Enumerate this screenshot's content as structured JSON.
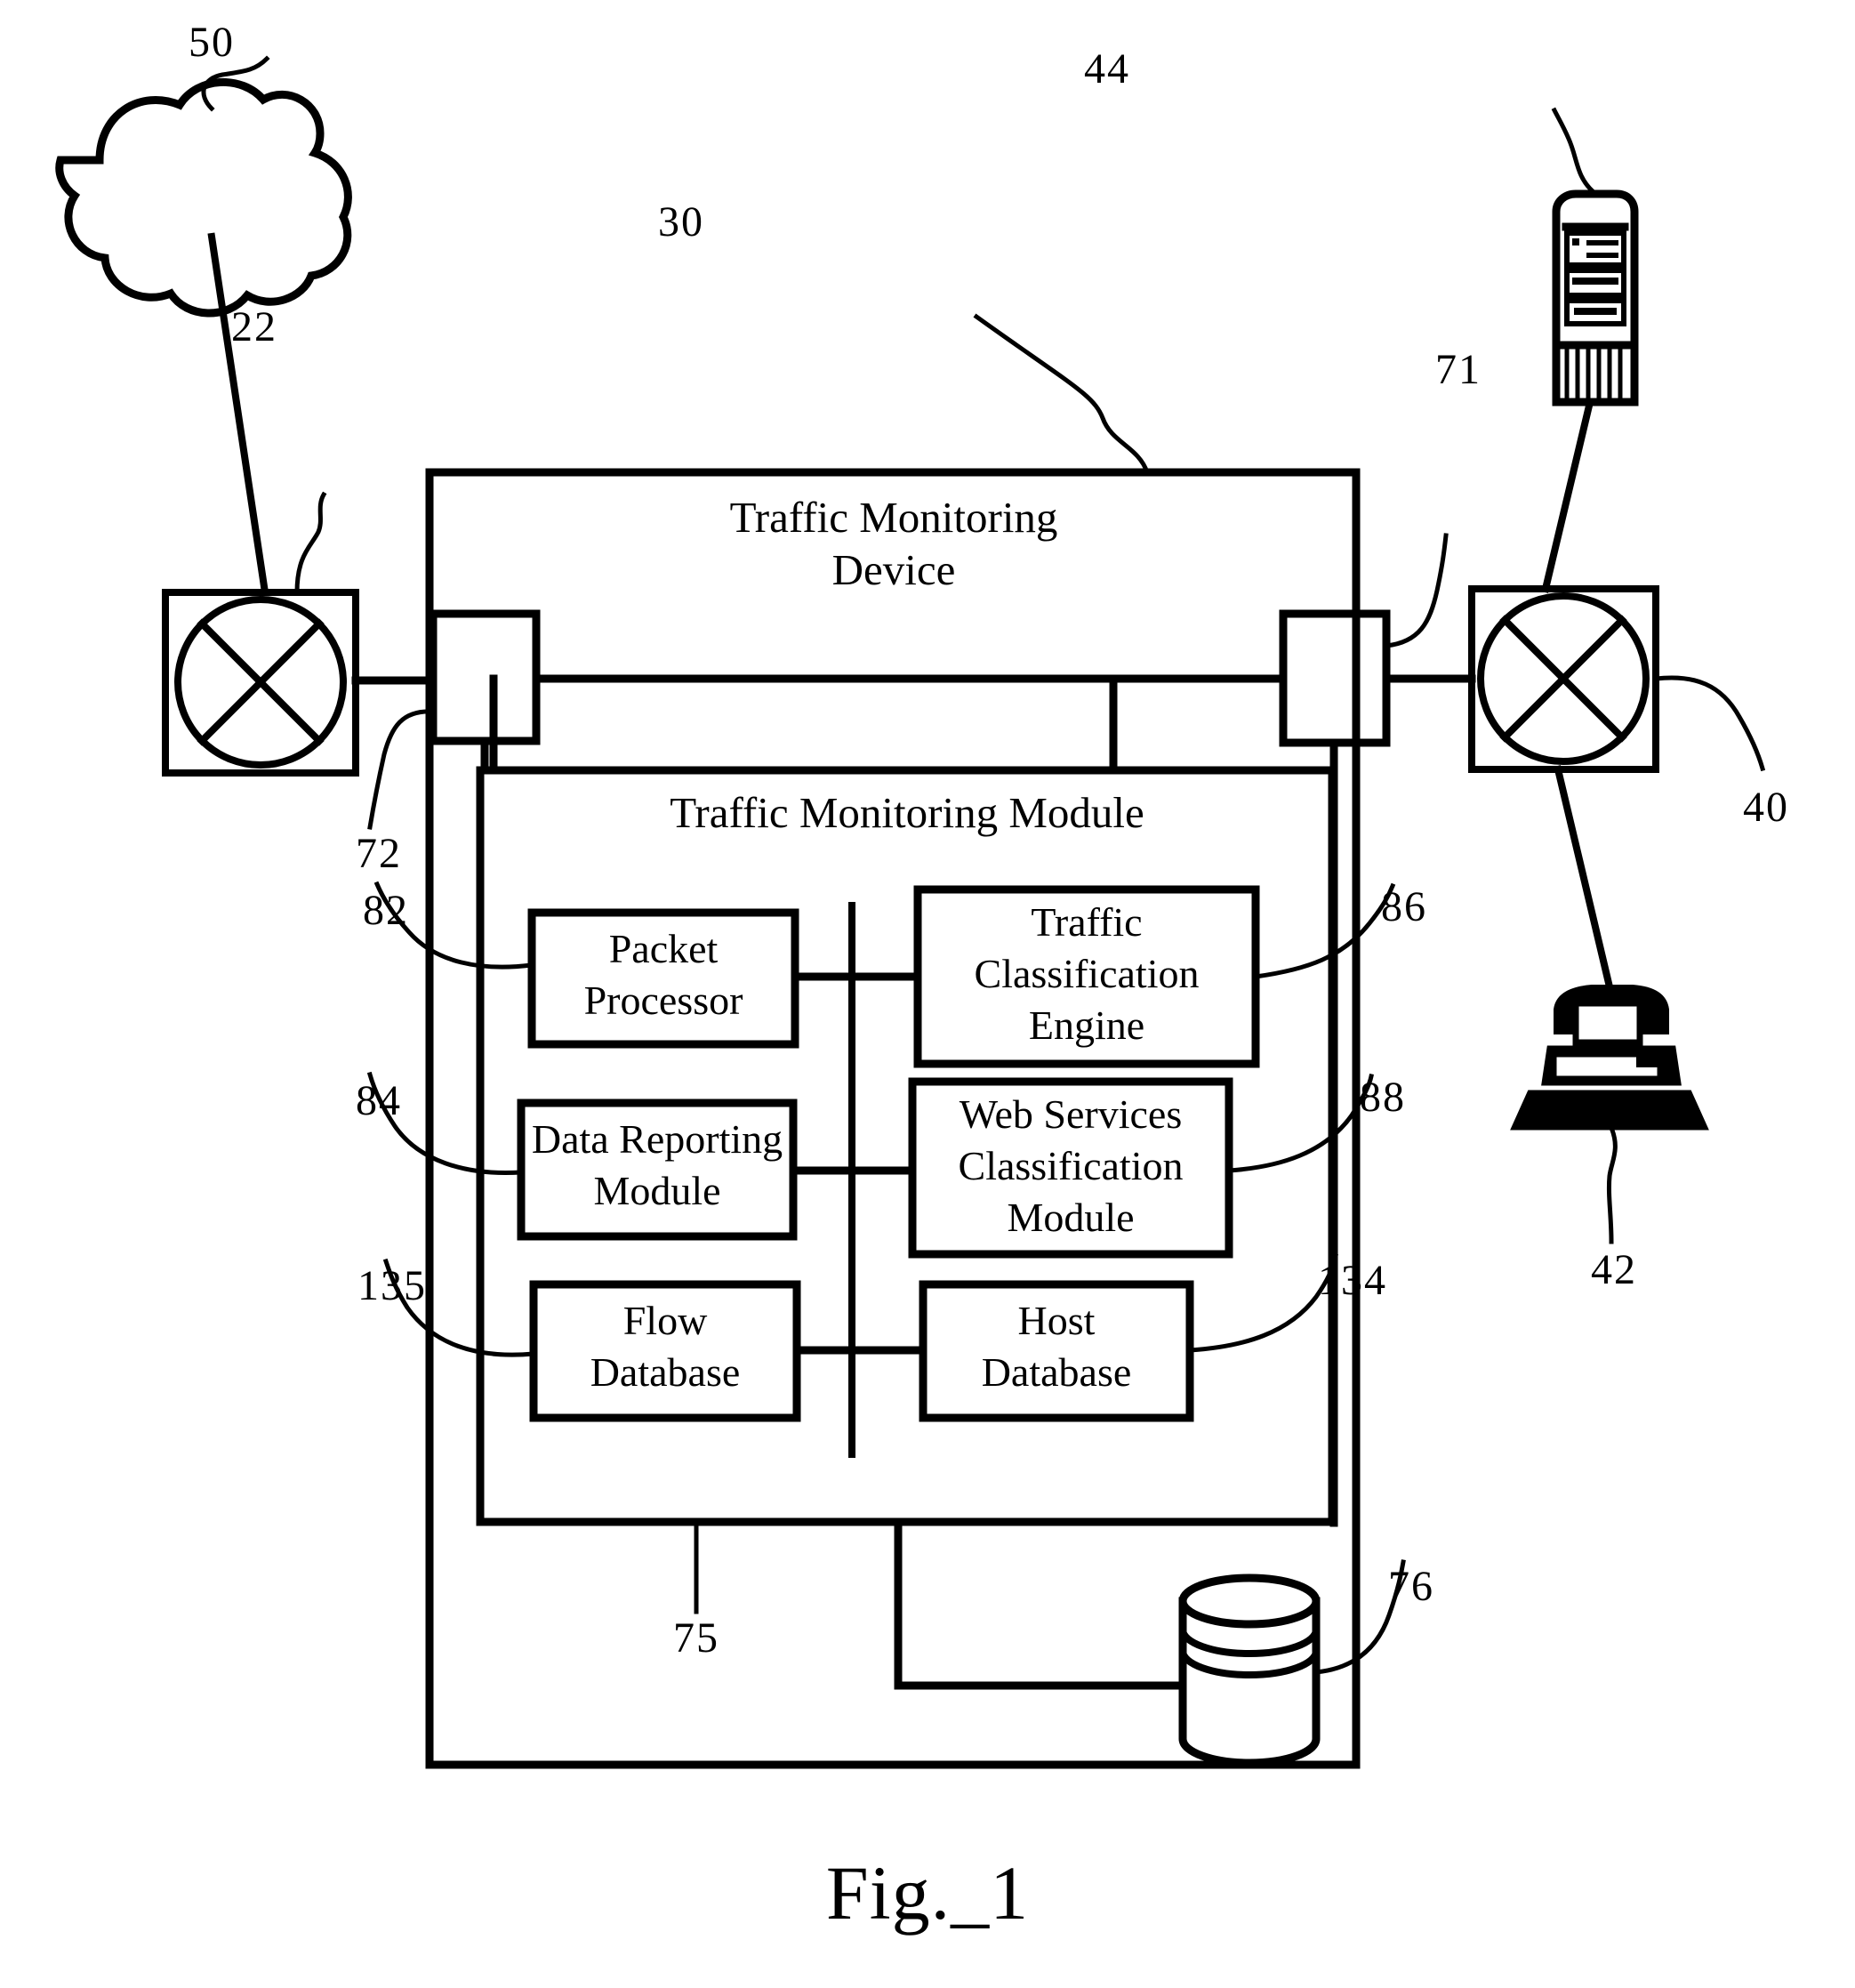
{
  "figure": {
    "caption": "Fig._1",
    "title_block": {
      "device_label_line1": "Traffic Monitoring",
      "device_label_line2": "Device",
      "module_label": "Traffic Monitoring Module"
    }
  },
  "components": {
    "cloud": {
      "ref": "50",
      "name": "network-cloud"
    },
    "router_left": {
      "ref": "22",
      "name": "router-left"
    },
    "router_right": {
      "ref": "40",
      "name": "router-right"
    },
    "server": {
      "ref": "44",
      "name": "server-tower"
    },
    "workstation": {
      "ref": "42",
      "name": "desktop-computer"
    },
    "iface_left": {
      "ref": "72",
      "name": "network-interface-left"
    },
    "iface_right": {
      "ref": "71",
      "name": "network-interface-right"
    },
    "device": {
      "ref": "30",
      "name": "traffic-monitoring-device"
    },
    "module": {
      "ref": "75",
      "name": "traffic-monitoring-module"
    },
    "datastore": {
      "ref": "76",
      "name": "persistent-data-store"
    }
  },
  "module_boxes": [
    {
      "ref": "82",
      "lines": [
        "Packet",
        "Processor"
      ],
      "name": "packet-processor"
    },
    {
      "ref": "86",
      "lines": [
        "Traffic",
        "Classification",
        "Engine"
      ],
      "name": "traffic-classification-engine"
    },
    {
      "ref": "84",
      "lines": [
        "Data Reporting",
        "Module"
      ],
      "name": "data-reporting-module"
    },
    {
      "ref": "88",
      "lines": [
        "Web Services",
        "Classification",
        "Module"
      ],
      "name": "web-services-classification-module"
    },
    {
      "ref": "135",
      "lines": [
        "Flow",
        "Database"
      ],
      "name": "flow-database"
    },
    {
      "ref": "134",
      "lines": [
        "Host",
        "Database"
      ],
      "name": "host-database"
    }
  ],
  "reference_numerals": {
    "n50": "50",
    "n22": "22",
    "n30": "30",
    "n44": "44",
    "n71": "71",
    "n40": "40",
    "n72": "72",
    "n42": "42",
    "n82": "82",
    "n86": "86",
    "n84": "84",
    "n88": "88",
    "n135": "135",
    "n134": "134",
    "n75": "75",
    "n76": "76"
  },
  "colors": {
    "ink": "#000000",
    "paper": "#ffffff"
  }
}
